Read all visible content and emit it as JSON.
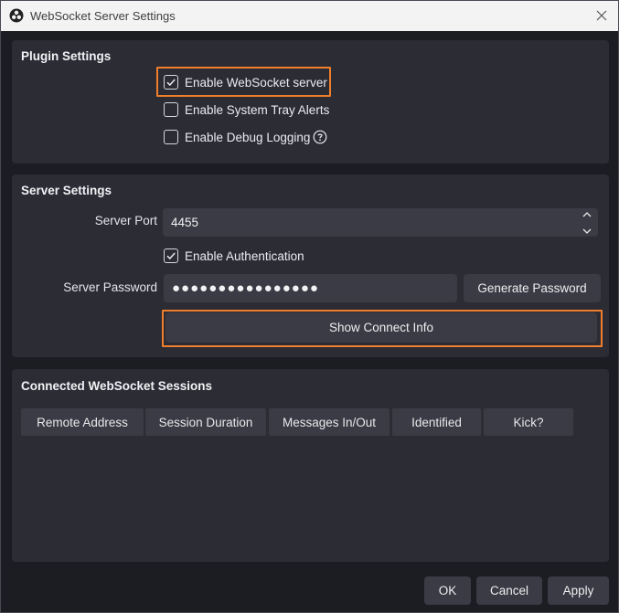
{
  "window": {
    "title": "WebSocket Server Settings"
  },
  "plugin_settings": {
    "title": "Plugin Settings",
    "enable_server": {
      "label": "Enable WebSocket server",
      "checked": true
    },
    "tray_alerts": {
      "label": "Enable System Tray Alerts",
      "checked": false
    },
    "debug_logging": {
      "label": "Enable Debug Logging",
      "checked": false
    }
  },
  "server_settings": {
    "title": "Server Settings",
    "port_label": "Server Port",
    "port_value": "4455",
    "auth": {
      "label": "Enable Authentication",
      "checked": true
    },
    "password_label": "Server Password",
    "password_value": "●●●●●●●●●●●●●●●●",
    "generate_label": "Generate Password",
    "connect_info_label": "Show Connect Info"
  },
  "sessions": {
    "title": "Connected WebSocket Sessions",
    "columns": [
      "Remote Address",
      "Session Duration",
      "Messages In/Out",
      "Identified",
      "Kick?"
    ]
  },
  "footer": {
    "ok": "OK",
    "cancel": "Cancel",
    "apply": "Apply"
  },
  "colors": {
    "highlight": "#f07e2a",
    "panel": "#2b2c34",
    "background": "#1c1d23"
  }
}
